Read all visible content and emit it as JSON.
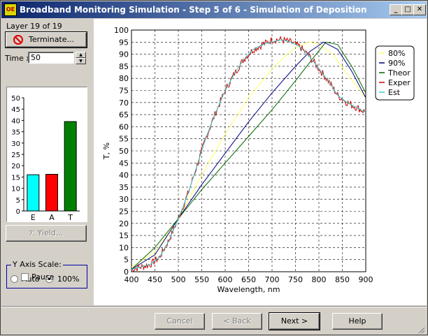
{
  "window": {
    "title": "Broadband Monitoring Simulation - Step 5 of 6 - Simulation of Deposition",
    "icon_label": "OE",
    "controls": {
      "minimize": "_",
      "maximize": "□",
      "close": "✕"
    }
  },
  "left": {
    "layer_status": "Layer 19 of 19",
    "terminate_label": "Terminate...",
    "time_label": "Time x",
    "time_value": "50",
    "yield_label": "Yield...",
    "y_axis_scale": {
      "title": "Y Axis Scale:",
      "auto": "Auto",
      "percent": "100%",
      "selected": "100%"
    },
    "pause_label": "Pause",
    "pause_checked": false
  },
  "footer": {
    "cancel": "Cancel",
    "back": "< Back",
    "next": "Next >",
    "help": "Help"
  },
  "colors": {
    "titlebar_start": "#0a246a",
    "titlebar_end": "#a6caf0",
    "bar_E": "#00ffff",
    "bar_A": "#ff0000",
    "bar_T": "#008000",
    "series_80": "#ffff66",
    "series_90": "#000080",
    "series_theor": "#006400",
    "series_exper": "#cc0000",
    "series_est": "#33cccc"
  },
  "bar_chart": {
    "type": "bar",
    "categories": [
      "E",
      "A",
      "T"
    ],
    "values": [
      16,
      16.2,
      39.5
    ],
    "colors": [
      "#00ffff",
      "#ff0000",
      "#008000"
    ],
    "ylim": [
      0,
      50
    ],
    "yticks": [
      "0",
      "5",
      "10",
      "15",
      "20",
      "25",
      "30",
      "35",
      "40",
      "45",
      "50"
    ]
  },
  "chart_data": {
    "type": "line",
    "xlabel": "Wavelength, nm",
    "ylabel": "T, %",
    "xlim": [
      400,
      900
    ],
    "ylim": [
      0,
      100
    ],
    "xticks": [
      "400",
      "450",
      "500",
      "550",
      "600",
      "650",
      "700",
      "750",
      "800",
      "850",
      "900"
    ],
    "yticks": [
      "0",
      "5",
      "10",
      "15",
      "20",
      "25",
      "30",
      "35",
      "40",
      "45",
      "50",
      "55",
      "60",
      "65",
      "70",
      "75",
      "80",
      "85",
      "90",
      "95",
      "100"
    ],
    "grid": true,
    "legend_position": "top-right",
    "series": [
      {
        "name": "80%",
        "color": "#ffff66",
        "x": [
          400,
          450,
          500,
          550,
          600,
          650,
          700,
          750,
          780,
          800,
          830,
          860,
          900
        ],
        "y": [
          2,
          8,
          22,
          40,
          57,
          72,
          84,
          93,
          95,
          94,
          90,
          82,
          72
        ]
      },
      {
        "name": "90%",
        "color": "#000080",
        "x": [
          400,
          450,
          500,
          550,
          600,
          650,
          700,
          750,
          780,
          810,
          840,
          870,
          900
        ],
        "y": [
          1,
          7,
          22,
          36,
          49,
          62,
          74,
          85,
          91,
          95,
          92,
          83,
          72
        ]
      },
      {
        "name": "Theor",
        "color": "#006400",
        "x": [
          400,
          450,
          500,
          550,
          600,
          650,
          700,
          750,
          790,
          815,
          840,
          870,
          900
        ],
        "y": [
          1,
          10,
          22,
          34,
          45,
          56,
          67,
          79,
          89,
          95,
          94,
          85,
          74
        ]
      },
      {
        "name": "Exper",
        "color": "#cc0000",
        "x": [
          400,
          420,
          440,
          460,
          480,
          500,
          520,
          540,
          560,
          580,
          600,
          620,
          640,
          660,
          680,
          700,
          720,
          740,
          760,
          780,
          800,
          820,
          840,
          860,
          880,
          900
        ],
        "y": [
          1,
          2,
          3,
          6,
          13,
          22,
          32,
          44,
          56,
          66,
          75,
          82,
          88,
          92,
          94,
          96,
          96,
          95,
          93,
          89,
          84,
          79,
          73,
          70,
          68,
          66
        ]
      },
      {
        "name": "Est",
        "color": "#33cccc",
        "x": [
          400,
          420,
          440,
          460,
          480,
          500,
          520,
          540,
          560,
          580,
          600,
          620,
          640,
          660,
          680,
          700,
          720,
          740,
          760,
          780,
          800,
          820,
          840,
          860,
          880,
          900
        ],
        "y": [
          1,
          2,
          3,
          6,
          13,
          22,
          32,
          44,
          56,
          66,
          75,
          82,
          88,
          92,
          94,
          95,
          96,
          95,
          93,
          89,
          84,
          79,
          73,
          70,
          68,
          66
        ]
      }
    ]
  }
}
